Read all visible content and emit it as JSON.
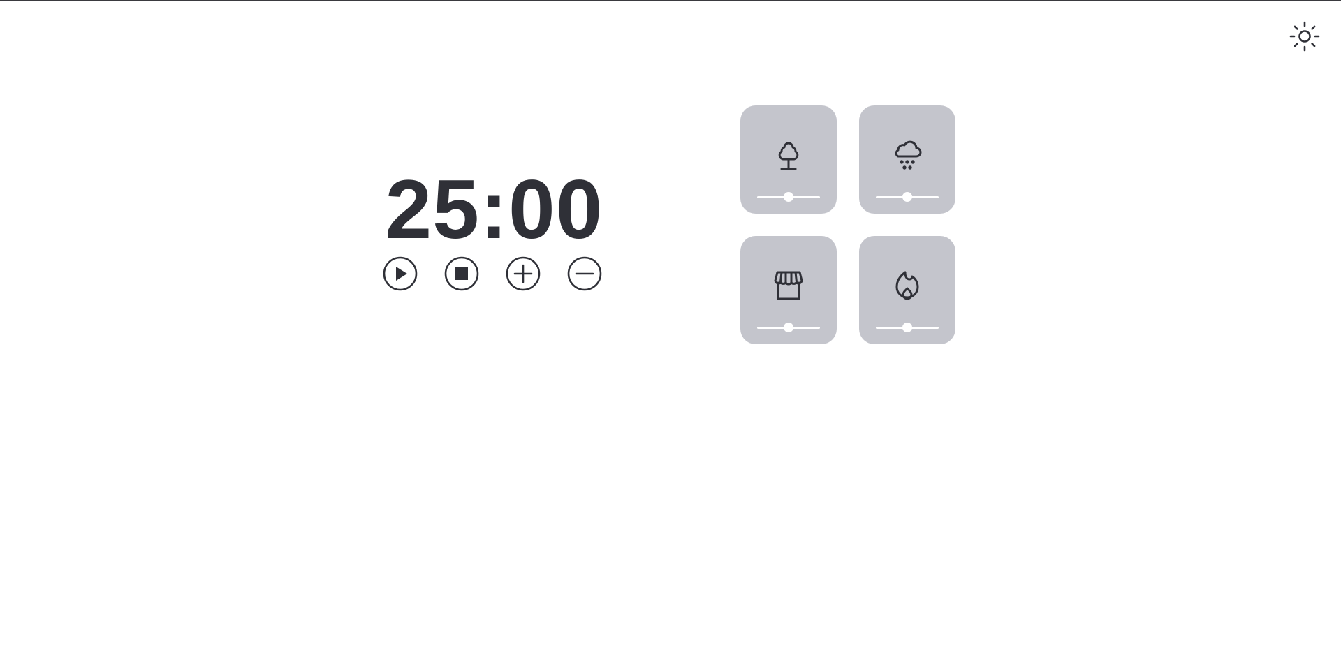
{
  "timer": {
    "display": "25:00"
  },
  "controls": [
    {
      "name": "play-button",
      "icon": "play-icon"
    },
    {
      "name": "stop-button",
      "icon": "stop-icon"
    },
    {
      "name": "increase-time-button",
      "icon": "plus-circle-icon"
    },
    {
      "name": "decrease-time-button",
      "icon": "minus-circle-icon"
    }
  ],
  "header": {
    "theme_toggle_icon": "sun-icon"
  },
  "sounds": [
    {
      "icon": "tree-icon",
      "volume": 0.5
    },
    {
      "icon": "rain-cloud-icon",
      "volume": 0.5
    },
    {
      "icon": "storefront-icon",
      "volume": 0.5
    },
    {
      "icon": "fire-icon",
      "volume": 0.5
    }
  ],
  "colors": {
    "text": "#2f3037",
    "tile_bg": "#c4c5cc",
    "slider": "#ffffff",
    "background": "#ffffff"
  }
}
